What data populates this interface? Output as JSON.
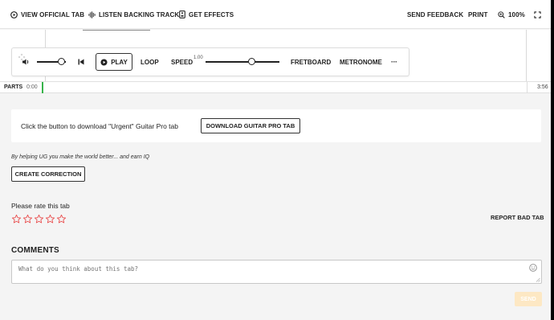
{
  "toolbar": {
    "view_official_tab": "VIEW OFFICIAL TAB",
    "listen_backing_track": "LISTEN BACKING TRACK",
    "get_effects": "GET EFFECTS",
    "send_feedback": "SEND FEEDBACK",
    "print": "PRINT",
    "zoom": "100%"
  },
  "player": {
    "play_label": "PLAY",
    "loop_label": "LOOP",
    "speed_label": "SPEED",
    "speed_value": "1.00",
    "fretboard_label": "FRETBOARD",
    "metronome_label": "METRONOME",
    "more_label": "···",
    "volume_level": 0.85,
    "speed_level": 0.63
  },
  "parts": {
    "label": "PARTS",
    "start_time": "0:00",
    "end_time": "3:56"
  },
  "download": {
    "text": "Click the button to download \"Urgent\" Guitar Pro tab",
    "button_label": "DOWNLOAD GUITAR PRO TAB"
  },
  "correction": {
    "help_text": "By helping UG you make the world better... and earn IQ",
    "button_label": "CREATE CORRECTION"
  },
  "rating": {
    "label": "Please rate this tab",
    "max_stars": 5,
    "filled_stars": 0,
    "star_color": "#e94b4b",
    "report_label": "REPORT BAD TAB"
  },
  "comments": {
    "title": "COMMENTS",
    "placeholder": "What do you think about this tab?",
    "value": "",
    "send_label": "SEND",
    "send_color": "#fde8c4"
  }
}
